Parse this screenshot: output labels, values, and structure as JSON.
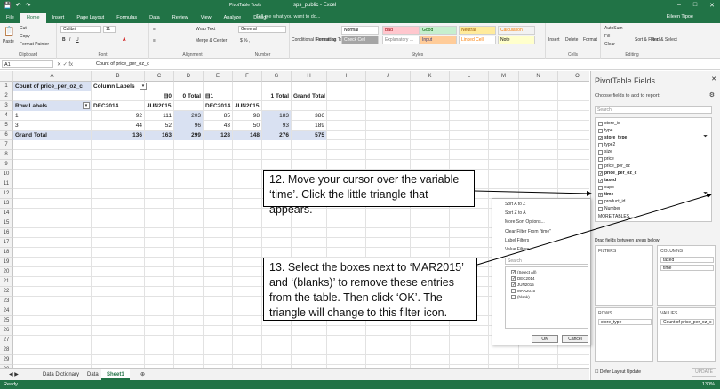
{
  "window": {
    "title": "sps_public - Excel",
    "context_tab": "PivotTable Tools",
    "user": "Eileen Tipoe",
    "tell_me": "Tell me what you want to do..."
  },
  "tabs": [
    "File",
    "Home",
    "Insert",
    "Page Layout",
    "Formulas",
    "Data",
    "Review",
    "View",
    "Analyze",
    "Design"
  ],
  "ribbon": {
    "clipboard": {
      "paste": "Paste",
      "cut": "Cut",
      "copy": "Copy",
      "format_painter": "Format Painter",
      "label": "Clipboard"
    },
    "font": {
      "name": "Calibri",
      "size": "11",
      "label": "Font"
    },
    "alignment": {
      "wrap": "Wrap Text",
      "merge": "Merge & Center",
      "label": "Alignment"
    },
    "number": {
      "format": "General",
      "label": "Number"
    },
    "styles": {
      "cond_format": "Conditional Formatting",
      "format_table": "Format as Table",
      "cells": [
        {
          "name": "Normal",
          "bg": "#ffffff",
          "fg": "#000000"
        },
        {
          "name": "Bad",
          "bg": "#ffc7ce",
          "fg": "#9c0006"
        },
        {
          "name": "Good",
          "bg": "#c6efce",
          "fg": "#006100"
        },
        {
          "name": "Neutral",
          "bg": "#ffeb9c",
          "fg": "#9c5700"
        },
        {
          "name": "Calculation",
          "bg": "#f2f2f2",
          "fg": "#fa7d00"
        },
        {
          "name": "Check Cell",
          "bg": "#a5a5a5",
          "fg": "#ffffff"
        },
        {
          "name": "Explanatory ...",
          "bg": "#ffffff",
          "fg": "#7f7f7f"
        },
        {
          "name": "Input",
          "bg": "#ffcc99",
          "fg": "#3f3f76"
        },
        {
          "name": "Linked Cell",
          "bg": "#ffffff",
          "fg": "#fa7d00"
        },
        {
          "name": "Note",
          "bg": "#ffffcc",
          "fg": "#000000"
        }
      ],
      "label": "Styles"
    },
    "cells": {
      "insert": "Insert",
      "delete": "Delete",
      "format": "Format",
      "label": "Cells"
    },
    "editing": {
      "autosum": "AutoSum",
      "fill": "Fill",
      "clear": "Clear",
      "sort": "Sort & Filter",
      "find": "Find & Select",
      "label": "Editing"
    }
  },
  "formula_bar": {
    "cell_ref": "A1",
    "content": "Count of price_per_oz_c"
  },
  "columns": [
    "A",
    "B",
    "C",
    "D",
    "E",
    "F",
    "G",
    "H",
    "I",
    "J",
    "K",
    "L",
    "M",
    "N",
    "O"
  ],
  "rows": [
    "1",
    "2",
    "3",
    "4",
    "5",
    "6",
    "7",
    "8",
    "9",
    "10",
    "11",
    "12",
    "13",
    "14",
    "15",
    "16",
    "17",
    "18",
    "19",
    "20",
    "21",
    "22",
    "23",
    "24",
    "25",
    "26",
    "27",
    "28",
    "29",
    "30",
    "31"
  ],
  "pivot": {
    "a1": "Count of price_per_oz_c",
    "b1": "Column Labels",
    "r2": {
      "c": "⊟0",
      "d": "0 Total",
      "e": "⊟1",
      "g": "1 Total",
      "h": "Grand Total"
    },
    "r3": {
      "a": "Row Labels",
      "b": "DEC2014",
      "c": "JUN2015",
      "e": "DEC2014",
      "f": "JUN2015"
    },
    "r4": {
      "a": "1",
      "b": "92",
      "c": "111",
      "d": "203",
      "e": "85",
      "f": "98",
      "g": "183",
      "h": "386"
    },
    "r5": {
      "a": "3",
      "b": "44",
      "c": "52",
      "d": "96",
      "e": "43",
      "f": "50",
      "g": "93",
      "h": "189"
    },
    "r6": {
      "a": "Grand Total",
      "b": "136",
      "c": "163",
      "d": "299",
      "e": "128",
      "f": "148",
      "g": "276",
      "h": "575"
    }
  },
  "sheets": [
    "Data Dictionary",
    "Data",
    "Sheet1"
  ],
  "status": {
    "ready": "Ready",
    "zoom": "130%"
  },
  "panel": {
    "title": "PivotTable Fields",
    "subtitle": "Choose fields to add to report:",
    "search": "Search",
    "fields": [
      {
        "name": "store_id",
        "checked": false
      },
      {
        "name": "type",
        "checked": false
      },
      {
        "name": "store_type",
        "checked": true
      },
      {
        "name": "type2",
        "checked": false
      },
      {
        "name": "size",
        "checked": false
      },
      {
        "name": "price",
        "checked": false
      },
      {
        "name": "price_per_oz",
        "checked": false
      },
      {
        "name": "price_per_oz_c",
        "checked": true
      },
      {
        "name": "taxed",
        "checked": true
      },
      {
        "name": "supp",
        "checked": false
      },
      {
        "name": "time",
        "checked": true
      },
      {
        "name": "product_id",
        "checked": false
      },
      {
        "name": "Number",
        "checked": false
      }
    ],
    "more_tables": "MORE TABLES...",
    "drag_text": "Drag fields between areas below:",
    "filters_label": "FILTERS",
    "columns_label": "COLUMNS",
    "rows_label": "ROWS",
    "values_label": "VALUES",
    "columns_items": [
      "taxed",
      "time"
    ],
    "rows_items": [
      "store_type"
    ],
    "values_items": [
      "Count of price_per_oz_c"
    ],
    "defer": "Defer Layout Update",
    "update": "UPDATE"
  },
  "filter_menu": {
    "sort_az": "Sort A to Z",
    "sort_za": "Sort Z to A",
    "more_sort": "More Sort Options...",
    "clear": "Clear Filter From \"time\"",
    "label_filters": "Label Filters",
    "value_filters": "Value Filters",
    "search": "Search",
    "items": [
      {
        "label": "(Select All)",
        "checked": true
      },
      {
        "label": "DEC2014",
        "checked": true
      },
      {
        "label": "JUN2015",
        "checked": true
      },
      {
        "label": "MAR2015",
        "checked": false
      },
      {
        "label": "(blank)",
        "checked": false
      }
    ],
    "ok": "OK",
    "cancel": "Cancel"
  },
  "callouts": {
    "step12": "12. Move your cursor over the variable ‘time’. Click the little triangle that appears.",
    "step13": "13. Select the boxes next to ‘MAR2015’ and ‘(blanks)’ to remove these entries from the table. Then click ‘OK’. The triangle will change to this filter icon."
  }
}
